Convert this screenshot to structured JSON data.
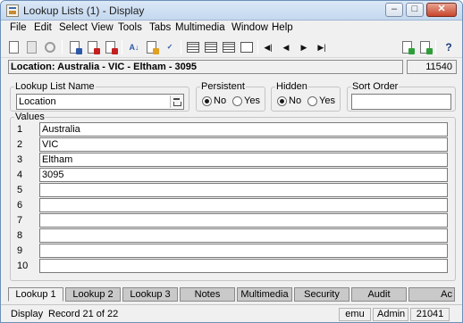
{
  "window": {
    "title": "Lookup Lists (1) - Display",
    "controls": {
      "minimize": "–",
      "maximize": "□",
      "close": "✕"
    }
  },
  "menu": [
    "File",
    "Edit",
    "Select",
    "View",
    "Tools",
    "Tabs",
    "Multimedia",
    "Window",
    "Help"
  ],
  "toolbar": {
    "icons": [
      "new-icon",
      "save-icon",
      "cancel-icon",
      "copy-record-icon",
      "delete-record-icon",
      "move-record-icon",
      "sort-icon",
      "edit-icon",
      "spellcheck-icon",
      "view-list-icon",
      "view-table-icon",
      "view-page-icon",
      "first-record-icon",
      "previous-record-icon",
      "next-record-icon",
      "last-record-icon",
      "add-item-icon",
      "remove-item-icon",
      "help-icon"
    ],
    "nav_first": "◀|",
    "nav_prev": "◀",
    "nav_next": "▶",
    "nav_last": "▶|",
    "help": "?"
  },
  "location_bar": {
    "text": "Location: Australia - VIC - Eltham - 3095",
    "record_number": "11540"
  },
  "form": {
    "lookup_list_name": {
      "label": "Lookup List Name",
      "value": "Location"
    },
    "persistent": {
      "label": "Persistent",
      "options": [
        "No",
        "Yes"
      ],
      "selected": "No"
    },
    "hidden": {
      "label": "Hidden",
      "options": [
        "No",
        "Yes"
      ],
      "selected": "No"
    },
    "sort_order": {
      "label": "Sort Order",
      "value": ""
    },
    "values_label": "Values",
    "values": [
      {
        "num": "1",
        "value": "Australia"
      },
      {
        "num": "2",
        "value": "VIC"
      },
      {
        "num": "3",
        "value": "Eltham"
      },
      {
        "num": "4",
        "value": "3095"
      },
      {
        "num": "5",
        "value": ""
      },
      {
        "num": "6",
        "value": ""
      },
      {
        "num": "7",
        "value": ""
      },
      {
        "num": "8",
        "value": ""
      },
      {
        "num": "9",
        "value": ""
      },
      {
        "num": "10",
        "value": ""
      }
    ]
  },
  "tabs": [
    "Lookup 1",
    "Lookup 2",
    "Lookup 3",
    "Notes",
    "Multimedia",
    "Security",
    "Audit",
    "Ac"
  ],
  "active_tab": "Lookup 1",
  "status": {
    "mode": "Display",
    "record": "Record 21 of 22",
    "user": "emu",
    "role": "Admin",
    "code": "21041"
  },
  "colors": {
    "title_bar": "#c4d8ef",
    "close_button": "#c7452b",
    "tab_inactive": "#c9c9c9"
  }
}
